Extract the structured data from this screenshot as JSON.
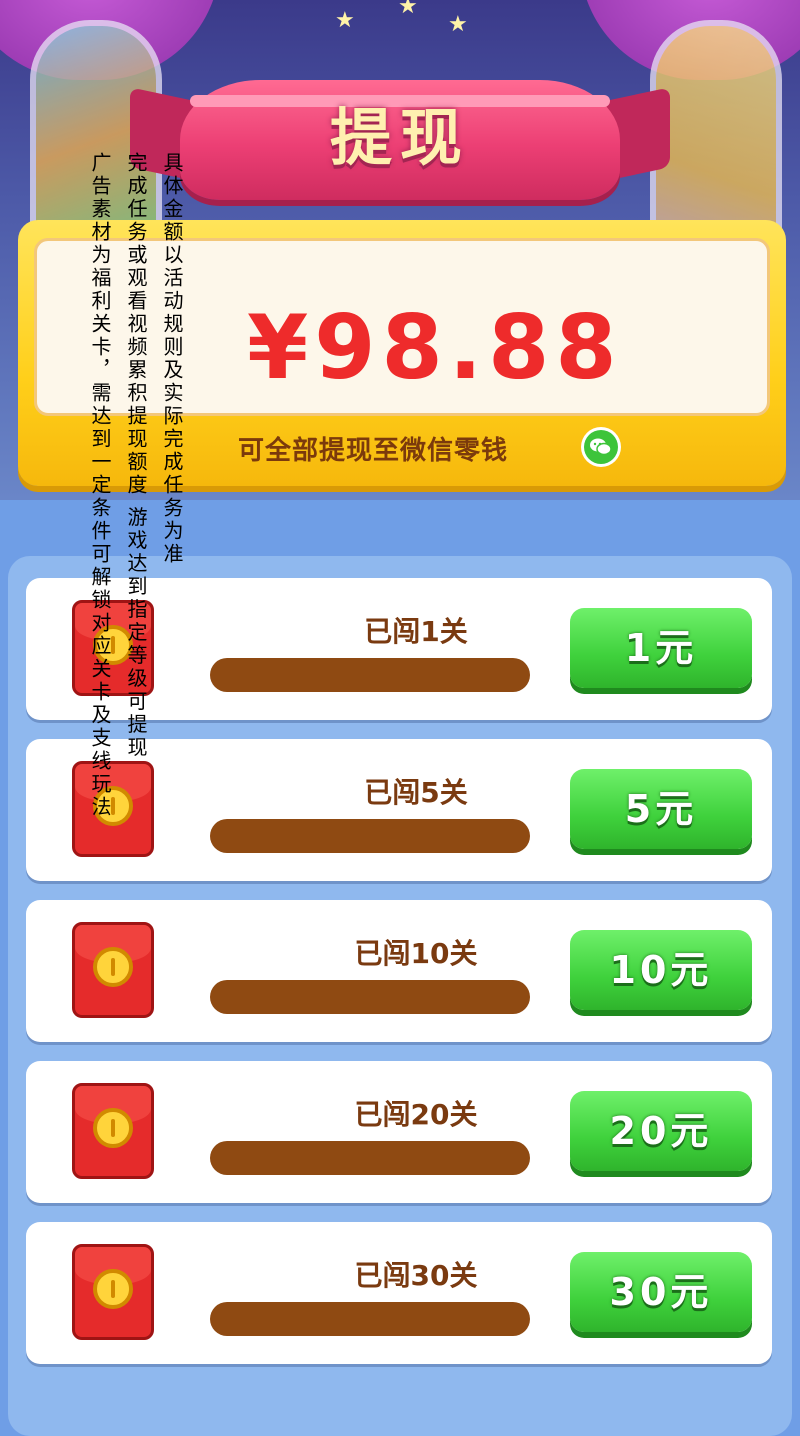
{
  "header": {
    "title": "提现"
  },
  "balance": {
    "amount": "¥98.88",
    "note": "可全部提现至微信零钱",
    "icon": "wechat-icon"
  },
  "rows": [
    {
      "label": "已闯1关",
      "button": "1元",
      "progress": 0
    },
    {
      "label": "已闯5关",
      "button": "5元",
      "progress": 0
    },
    {
      "label": "已闯10关",
      "button": "10元",
      "progress": 0
    },
    {
      "label": "已闯20关",
      "button": "20元",
      "progress": 0
    },
    {
      "label": "已闯30关",
      "button": "30元",
      "progress": 0
    }
  ],
  "disclaimers": {
    "col1": "具体金额以活动规则及实际完成任务为准",
    "col2": "完成任务或观看视频累积提现额度  游戏达到指定等级可提现",
    "col3": "广告素材为福利关卡，需达到一定条件可解锁对应关卡及支线玩法"
  },
  "colors": {
    "accent_red": "#ee2b2b",
    "button_green": "#3fd13c",
    "ribbon_pink": "#ec3f74",
    "card_yellow": "#ffcf1a"
  }
}
